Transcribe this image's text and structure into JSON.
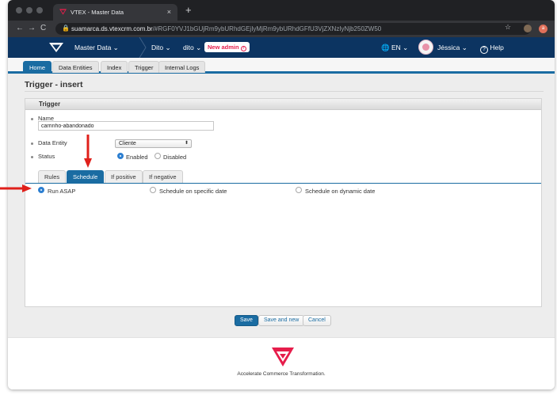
{
  "browser": {
    "tab_title": "VTEX - Master Data",
    "close_glyph": "×",
    "newtab_glyph": "+",
    "url_host": "suamarca.ds.vtexcrm.com.br",
    "url_path": "/#RGF0YVJ1bGUjRm9ybURhdGEjIyMjRm9ybURhdGFfU3VjZXNzIyNjb250ZW50",
    "profile_initial": "a",
    "back_glyph": "←",
    "forward_glyph": "→",
    "reload_glyph": "C",
    "lock_glyph": "🔒",
    "star_glyph": "☆"
  },
  "topbar": {
    "app_label": "Master Data ⌄",
    "store_label": "Dito ⌄",
    "account_label": "dito ⌄",
    "badge_label": "New admin",
    "badge_info": "?",
    "language_label": "EN ⌄",
    "user_label": "Jéssica ⌄",
    "help_label": "Help",
    "globe_glyph": "🌐",
    "help_glyph": "?"
  },
  "nav_tabs": [
    "Home",
    "Data Entities",
    "Index",
    "Trigger",
    "Internal Logs"
  ],
  "page": {
    "title": "Trigger - insert",
    "panel_title": "Trigger",
    "name_label": "Name",
    "name_value": "carrinho-abandonado",
    "entity_label": "Data Entity",
    "entity_value": "Cliente",
    "select_arrows": "⬍",
    "status_label": "Status",
    "status_enabled": "Enabled",
    "status_disabled": "Disabled",
    "subtabs": [
      "Rules",
      "Schedule",
      "If positive",
      "If negative"
    ],
    "schedule_options": [
      "Run ASAP",
      "Schedule on specific date",
      "Schedule on dynamic date"
    ]
  },
  "buttons": {
    "save": "Save",
    "save_and_new": "Save and new",
    "cancel": "Cancel"
  },
  "footer": {
    "tagline": "Accelerate Commerce Transformation."
  },
  "colors": {
    "topbar": "#0c3461",
    "accent_blue": "#1a6ca2",
    "vtex_pink": "#e61d4b",
    "annotation_red": "#e0201b"
  }
}
